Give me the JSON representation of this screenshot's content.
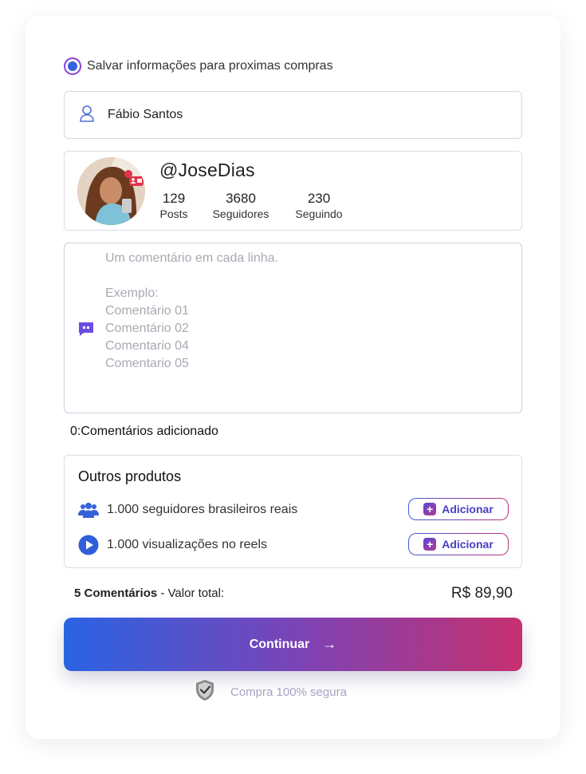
{
  "save_info": {
    "label": "Salvar informações para proximas compras",
    "checked": true
  },
  "name_field": {
    "value": "Fábio Santos",
    "icon": "user-icon"
  },
  "profile": {
    "username": "@JoseDias",
    "stats": [
      {
        "value": "129",
        "label": "Posts"
      },
      {
        "value": "3680",
        "label": "Seguidores"
      },
      {
        "value": "230",
        "label": "Seguindo"
      }
    ]
  },
  "comments": {
    "placeholder": "Um comentário em cada linha.\n\nExemplo:\nComentário 01\nComentário 02\nComentario 04\nComentario 05",
    "counter": "0:Comentários adicionado",
    "icon": "chat-icon"
  },
  "other_products": {
    "title": "Outros produtos",
    "items": [
      {
        "label": "1.000 seguidores brasileiros reais",
        "button": "Adicionar",
        "icon": "users-icon"
      },
      {
        "label": "1.000 visualizações no reels",
        "button": "Adicionar",
        "icon": "play-icon"
      }
    ]
  },
  "summary": {
    "count": "5 Comentários",
    "label": " - Valor total:",
    "price": "R$ 89,90"
  },
  "continue_button": {
    "label": "Continuar",
    "icon": "arrow-right-icon"
  },
  "secure": {
    "label": "Compra 100% segura",
    "icon": "shield-check-icon"
  },
  "colors": {
    "primary": "#2a63e3",
    "secondary": "#c6306f",
    "accent": "#5a46d6"
  }
}
